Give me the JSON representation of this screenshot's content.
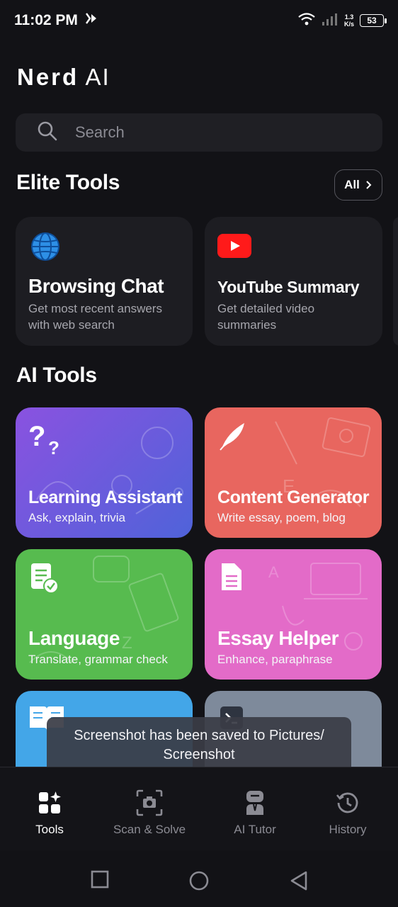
{
  "status": {
    "time": "11:02 PM",
    "speed_value": "1.3",
    "speed_unit": "K/s",
    "battery": "53"
  },
  "app": {
    "logo_bold": "Nerd",
    "logo_light": "AI"
  },
  "search": {
    "placeholder": "Search"
  },
  "elite": {
    "heading": "Elite Tools",
    "all_label": "All",
    "cards": [
      {
        "title": "Browsing Chat",
        "desc": "Get most recent answers with web search",
        "icon": "globe-icon"
      },
      {
        "title": "YouTube Summary",
        "desc": "Get detailed video summaries",
        "icon": "youtube-icon"
      }
    ]
  },
  "ai_tools": {
    "heading": "AI Tools",
    "cards": [
      {
        "title": "Learning Assistant",
        "desc": "Ask, explain, trivia",
        "color": "#6f5fd8",
        "icon": "question-marks-icon"
      },
      {
        "title": "Content Generator",
        "desc": "Write essay, poem, blog",
        "color": "#e8665f",
        "icon": "quill-icon"
      },
      {
        "title": "Language",
        "desc": "Translate, grammar check",
        "color": "#57bb4f",
        "icon": "document-check-icon"
      },
      {
        "title": "Essay Helper",
        "desc": "Enhance, paraphrase",
        "color": "#e36bc8",
        "icon": "document-icon"
      },
      {
        "title": "",
        "desc": "",
        "color": "#43a6e8",
        "icon": "book-icon"
      },
      {
        "title": "",
        "desc": "",
        "color": "#7e8a9b",
        "icon": "terminal-icon"
      }
    ]
  },
  "toast": {
    "line1": "Screenshot has been saved to  Pictures/",
    "line2": "Screenshot"
  },
  "bottom_nav": [
    {
      "label": "Tools",
      "icon": "tools-icon",
      "active": true
    },
    {
      "label": "Scan & Solve",
      "icon": "scan-camera-icon",
      "active": false
    },
    {
      "label": "AI Tutor",
      "icon": "tutor-icon",
      "active": false
    },
    {
      "label": "History",
      "icon": "history-icon",
      "active": false
    }
  ]
}
